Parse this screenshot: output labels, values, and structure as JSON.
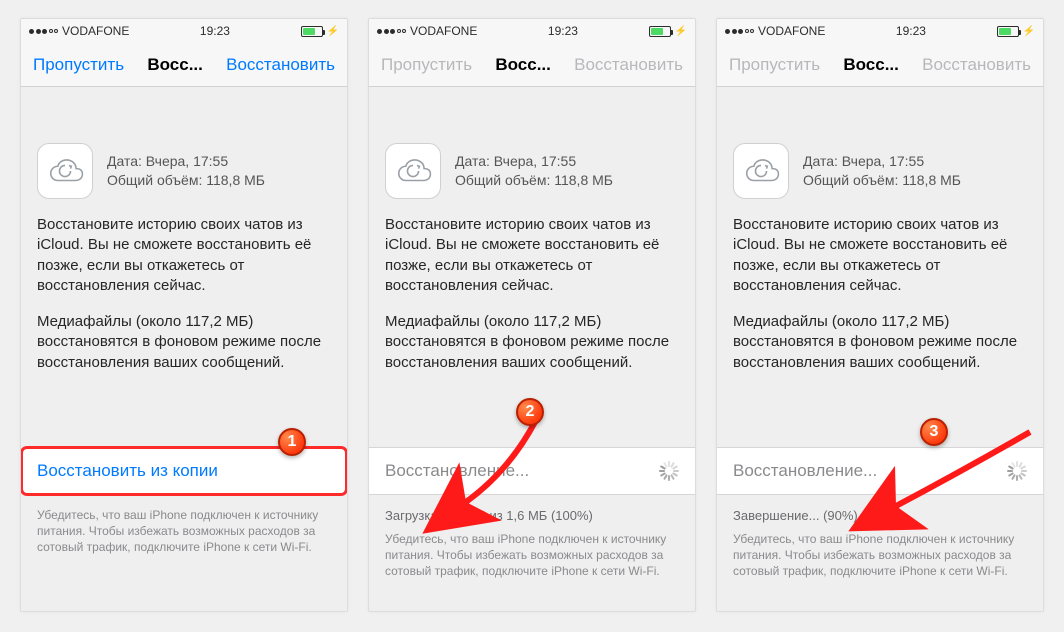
{
  "status_bar": {
    "carrier": "VODAFONE",
    "time": "19:23"
  },
  "nav": {
    "skip": "Пропустить",
    "title": "Восс...",
    "restore": "Восстановить"
  },
  "backup": {
    "date_label": "Дата: Вчера, 17:55",
    "size_label": "Общий объём: 118,8 МБ"
  },
  "body": {
    "p1": "Восстановите историю своих чатов из iCloud. Вы не сможете восстановить её позже, если вы откажетесь от восстановления сейчас.",
    "p2": "Медиафайлы (около 117,2 МБ) восстановятся в фоновом режиме после восстановления ваших сообщений."
  },
  "actions": {
    "restore_from_copy": "Восстановить из копии",
    "restoring": "Восстановление...",
    "download_progress": "Загрузка: 1,6 МБ из 1,6 МБ (100%)",
    "finishing": "Завершение... (90%)"
  },
  "footer_hint": "Убедитесь, что ваш iPhone подключен к источнику питания. Чтобы избежать возможных расходов за сотовый трафик, подключите iPhone к сети Wi-Fi.",
  "annotations": {
    "b1": "1",
    "b2": "2",
    "b3": "3"
  }
}
